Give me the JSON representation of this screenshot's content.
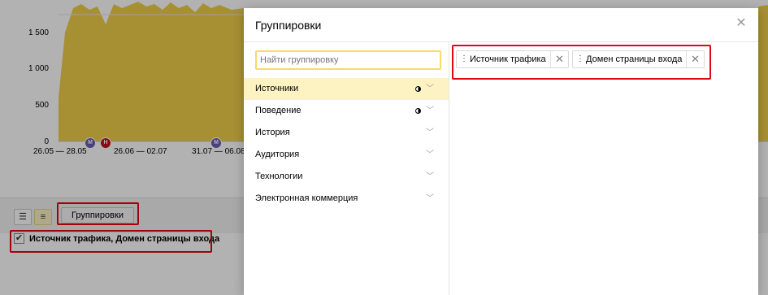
{
  "chart": {
    "y_ticks": [
      "1 500",
      "1 000",
      "500",
      "0"
    ],
    "x_ticks": [
      "26.05 — 28.05",
      "26.06 — 02.07",
      "31.07 — 06.08"
    ],
    "markers": [
      {
        "label": "M",
        "type": "m"
      },
      {
        "label": "H",
        "type": "n"
      },
      {
        "label": "M",
        "type": "m"
      }
    ],
    "area_color": "#f0cf4a"
  },
  "toolbar": {
    "list_view_icon": "list-icon",
    "tree_view_icon": "tree-list-icon",
    "groups_button_label": "Группировки"
  },
  "selected_grouping": {
    "checked": true,
    "label": "Источник трафика, Домен страницы входа"
  },
  "modal": {
    "title": "Группировки",
    "close_icon": "close-icon",
    "search_placeholder": "Найти группировку",
    "categories": [
      {
        "label": "Источники",
        "selected": true,
        "partial": true
      },
      {
        "label": "Поведение",
        "selected": false,
        "partial": true
      },
      {
        "label": "История",
        "selected": false,
        "partial": false
      },
      {
        "label": "Аудитория",
        "selected": false,
        "partial": false
      },
      {
        "label": "Технологии",
        "selected": false,
        "partial": false
      },
      {
        "label": "Электронная коммерция",
        "selected": false,
        "partial": false
      }
    ],
    "chosen": [
      {
        "label": "Источник трафика"
      },
      {
        "label": "Домен страницы входа"
      }
    ]
  },
  "colors": {
    "highlight": "#e30613",
    "selected_row": "#fdf2c2",
    "search_border": "#f8d96a"
  }
}
